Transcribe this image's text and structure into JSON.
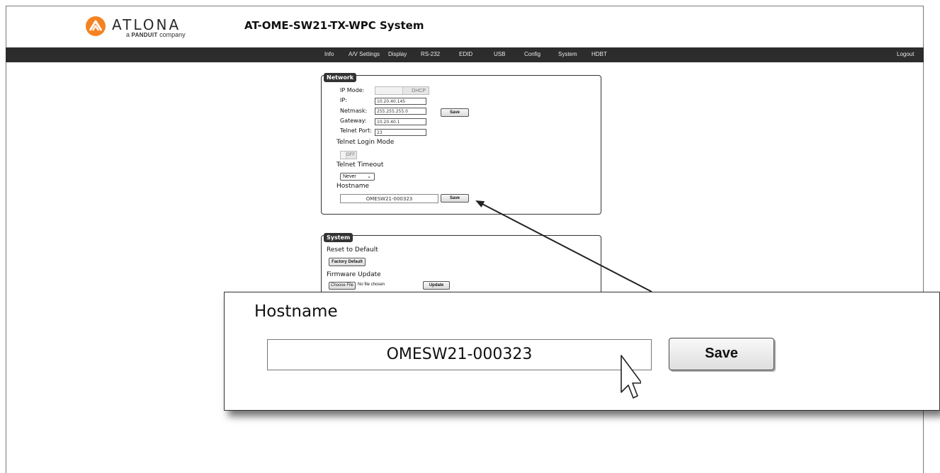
{
  "header": {
    "brand": "ATLONA",
    "tagline_prefix": "a",
    "tagline_brand": "PANDUIT",
    "tagline_suffix": "company",
    "device_title": "AT-OME-SW21-TX-WPC  System",
    "logo_color": "#f58220"
  },
  "nav": {
    "items": [
      "Info",
      "A/V Settings",
      "Display",
      "RS-232",
      "EDID",
      "USB",
      "Config",
      "System",
      "HDBT"
    ],
    "logout": "Logout"
  },
  "network": {
    "title": "Network",
    "ip_mode_label": "IP Mode:",
    "ip_mode_value": "DHCP",
    "ip_label": "IP:",
    "ip_value": "10.20.40.145",
    "netmask_label": "Netmask:",
    "netmask_value": "255.255.255.0",
    "gateway_label": "Gateway:",
    "gateway_value": "10.20.40.1",
    "telnet_port_label": "Telnet Port:",
    "telnet_port_value": "23",
    "save_label": "Save",
    "telnet_login_mode_label": "Telnet Login Mode",
    "telnet_login_mode_value": "OFF",
    "telnet_timeout_label": "Telnet Timeout",
    "telnet_timeout_value": "Never",
    "hostname_label": "Hostname",
    "hostname_value": "OMESW21-000323",
    "hostname_save_label": "Save"
  },
  "system": {
    "title": "System",
    "reset_label": "Reset to Default",
    "factory_default_label": "Factory Default",
    "firmware_label": "Firmware Update",
    "choose_file_label": "Choose File",
    "no_file_label": "No file chosen",
    "update_label": "Update"
  },
  "zoom": {
    "hostname_label": "Hostname",
    "hostname_value": "OMESW21-000323",
    "save_label": "Save"
  }
}
